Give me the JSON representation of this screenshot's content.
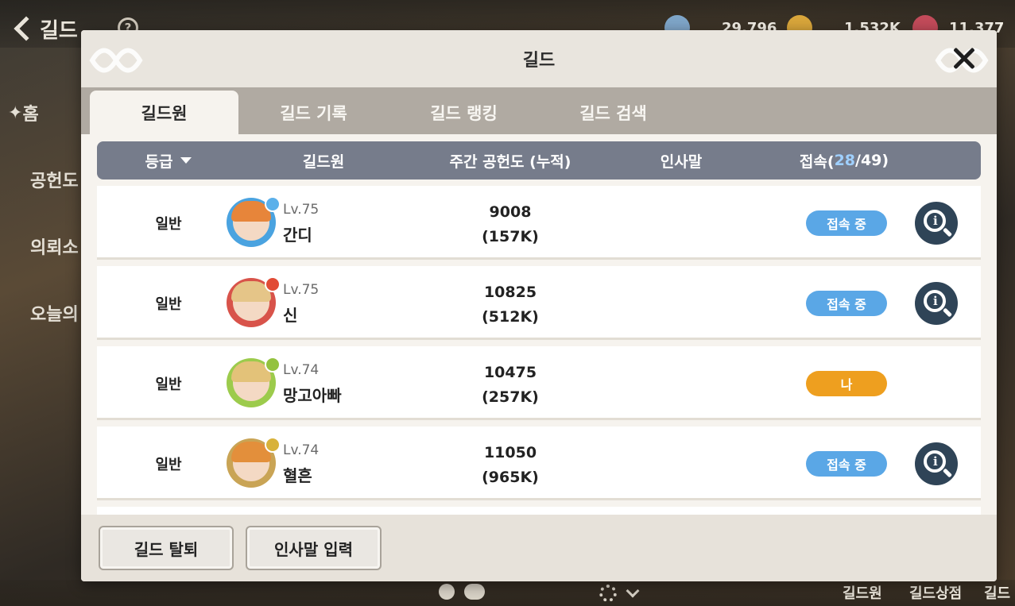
{
  "hud": {
    "back_label": "길드",
    "help_icon": "?",
    "currencies": [
      {
        "icon": "gem-coin-icon",
        "value": "29,796",
        "color": "#7fa6c9"
      },
      {
        "icon": "gold-coin-icon",
        "value": "1,532K",
        "color": "#d9a63b"
      },
      {
        "icon": "ticket-icon",
        "value": "11,377",
        "color": "#c34b5a"
      }
    ]
  },
  "side_menu": {
    "items": [
      "홈",
      "공헌도",
      "의뢰소",
      "오늘의"
    ]
  },
  "bottom_tabs": [
    "길드원",
    "길드상점",
    "길드"
  ],
  "modal": {
    "title": "길드",
    "tabs": [
      "길드원",
      "길드 기록",
      "길드 랭킹",
      "길드 검색"
    ],
    "active_tab": 0,
    "columns": {
      "rank": "등급",
      "member": "길드원",
      "contribution": "주간 공헌도 (누적)",
      "greeting": "인사말",
      "connect_label": "접속(",
      "online_count": "28",
      "total_sep": "/49)"
    },
    "members": [
      {
        "rank": "일반",
        "level": "Lv.75",
        "name": "간디",
        "weekly": "9008",
        "total": "(157K)",
        "status": "접속 중",
        "is_me": false,
        "ring": "#4aa3e0",
        "hair": "#e7853a",
        "badge": "#5bb0ea"
      },
      {
        "rank": "일반",
        "level": "Lv.75",
        "name": "신",
        "weekly": "10825",
        "total": "(512K)",
        "status": "접속 중",
        "is_me": false,
        "ring": "#d8534a",
        "hair": "#e5c588",
        "badge": "#e14b35"
      },
      {
        "rank": "일반",
        "level": "Lv.74",
        "name": "망고아빠",
        "weekly": "10475",
        "total": "(257K)",
        "status": "나",
        "is_me": true,
        "ring": "#9ccb4c",
        "hair": "#e3c279",
        "badge": "#93c23e"
      },
      {
        "rank": "일반",
        "level": "Lv.74",
        "name": "혈흔",
        "weekly": "11050",
        "total": "(965K)",
        "status": "접속 중",
        "is_me": false,
        "ring": "#c9a455",
        "hair": "#e38f3b",
        "badge": "#d8b23a"
      }
    ],
    "footer": {
      "leave_label": "길드 탈퇴",
      "greeting_label": "인사말 입력"
    }
  }
}
